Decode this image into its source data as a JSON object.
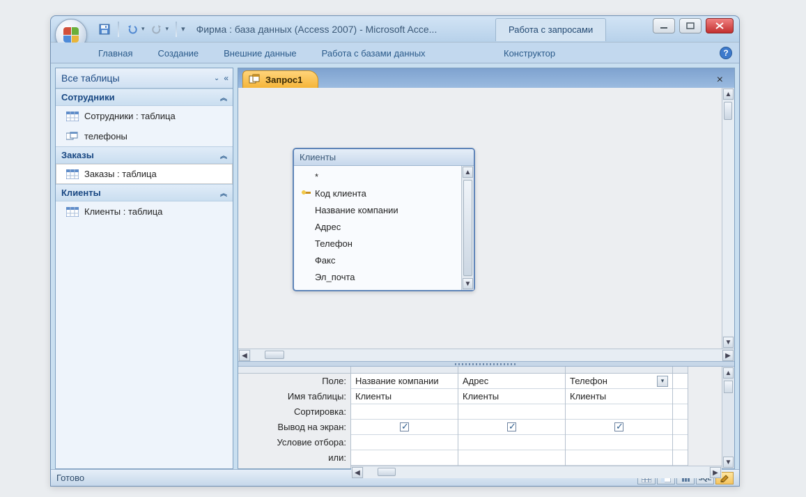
{
  "title": "Фирма : база данных (Access 2007) - Microsoft Acce...",
  "context_tab": "Работа с запросами",
  "ribbon": {
    "tabs": [
      "Главная",
      "Создание",
      "Внешние данные",
      "Работа с базами данных"
    ],
    "context": "Конструктор"
  },
  "nav": {
    "header": "Все таблицы",
    "groups": [
      {
        "title": "Сотрудники",
        "items": [
          {
            "label": "Сотрудники : таблица",
            "icon": "table"
          },
          {
            "label": "телефоны",
            "icon": "query"
          }
        ]
      },
      {
        "title": "Заказы",
        "items": [
          {
            "label": "Заказы : таблица",
            "icon": "table",
            "selected": true
          }
        ]
      },
      {
        "title": "Клиенты",
        "items": [
          {
            "label": "Клиенты : таблица",
            "icon": "table"
          }
        ]
      }
    ]
  },
  "document": {
    "tab_label": "Запрос1"
  },
  "field_list": {
    "title": "Клиенты",
    "fields": [
      "*",
      "Код клиента",
      "Название компании",
      "Адрес",
      "Телефон",
      "Факс",
      "Эл_почта"
    ],
    "key_index": 1
  },
  "qbe": {
    "rows": [
      "Поле:",
      "Имя таблицы:",
      "Сортировка:",
      "Вывод на экран:",
      "Условие отбора:",
      "или:"
    ],
    "columns": [
      {
        "field": "Название компании",
        "table": "Клиенты",
        "show": true
      },
      {
        "field": "Адрес",
        "table": "Клиенты",
        "show": true
      },
      {
        "field": "Телефон",
        "table": "Клиенты",
        "show": true,
        "active": true
      }
    ]
  },
  "status": {
    "text": "Готово",
    "sql_label": "SQL"
  }
}
